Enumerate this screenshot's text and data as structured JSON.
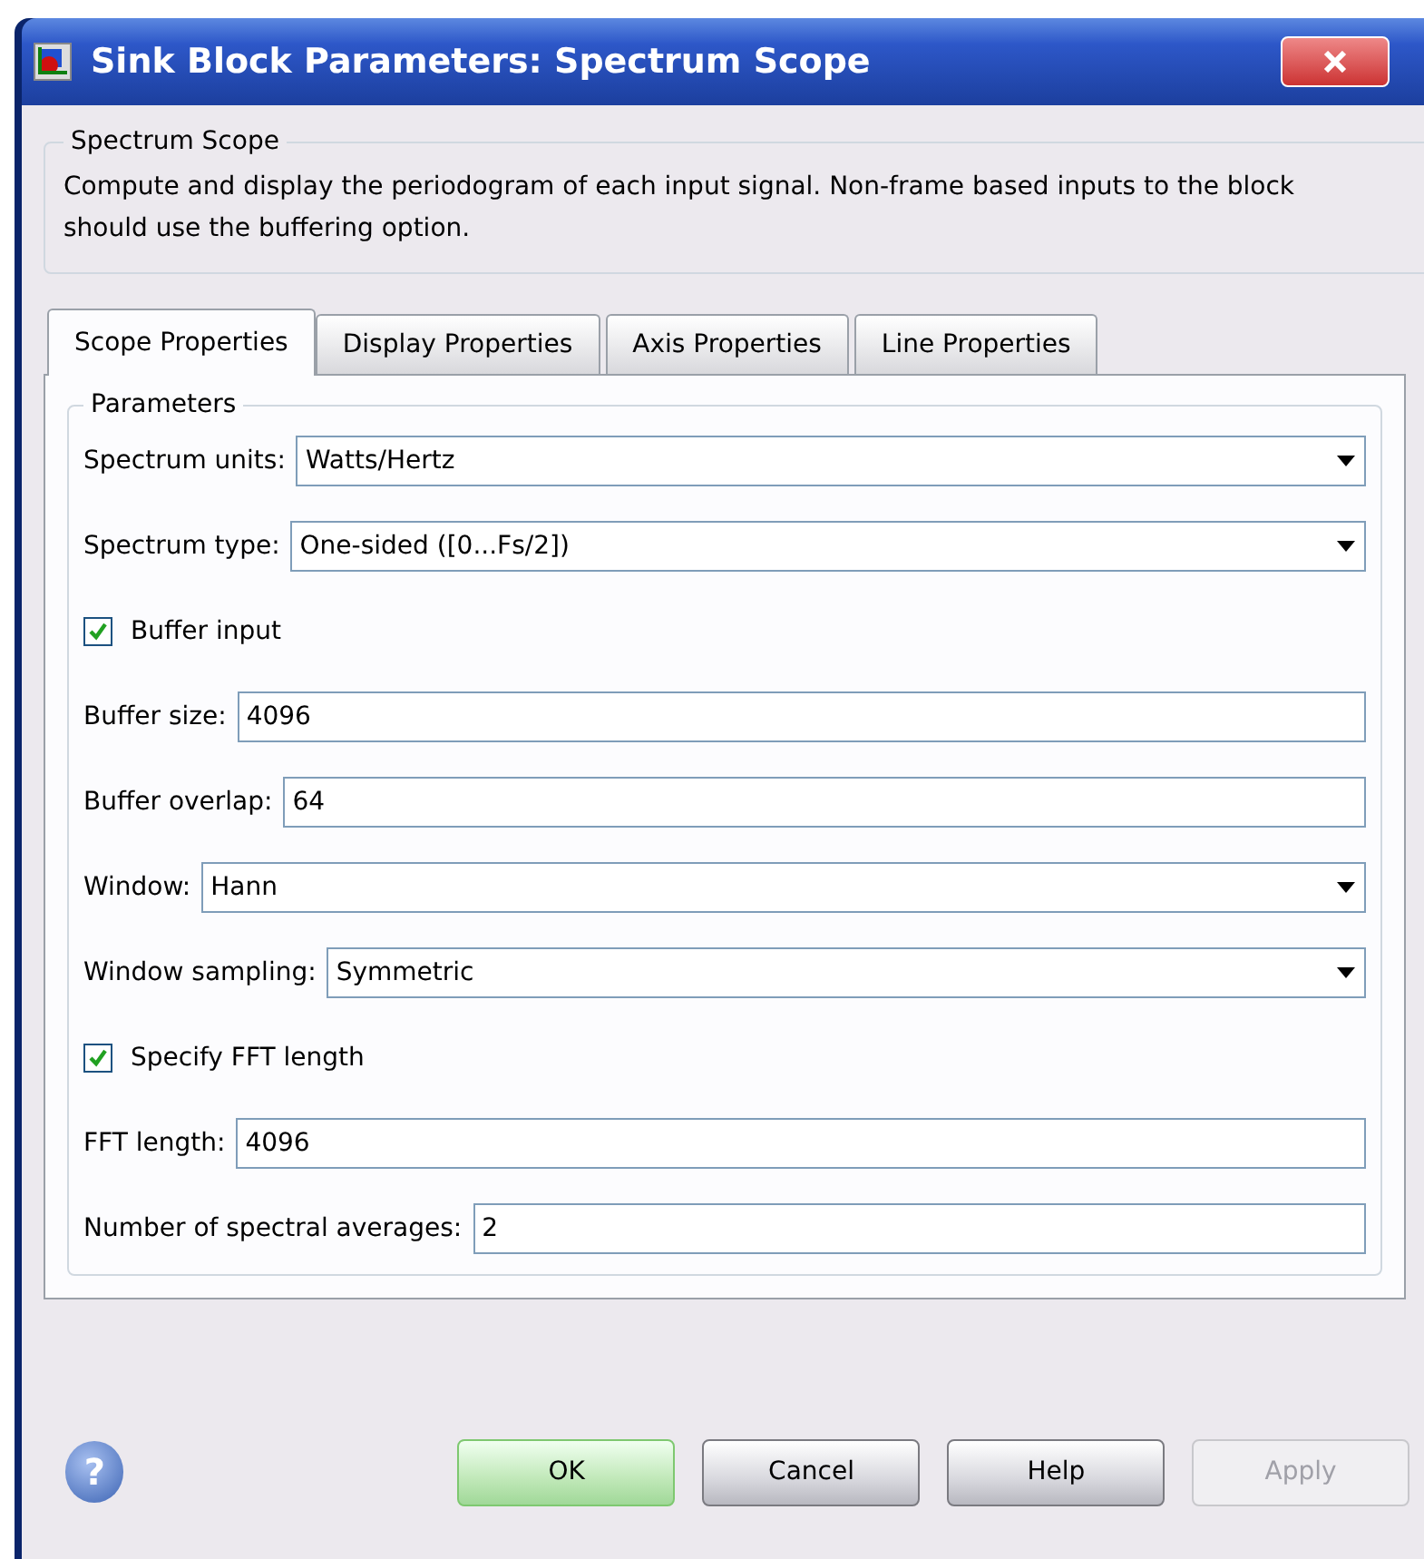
{
  "window": {
    "title": "Sink Block Parameters: Spectrum Scope"
  },
  "description_group": {
    "title": "Spectrum Scope",
    "text": "Compute and display the periodogram of each input signal.  Non-frame based inputs to the block should use the buffering option."
  },
  "tabs": [
    {
      "label": "Scope Properties",
      "selected": true
    },
    {
      "label": "Display Properties",
      "selected": false
    },
    {
      "label": "Axis Properties",
      "selected": false
    },
    {
      "label": "Line Properties",
      "selected": false
    }
  ],
  "parameters": {
    "title": "Parameters",
    "fields": [
      {
        "kind": "dropdown",
        "label": "Spectrum units:",
        "value": "Watts/Hertz"
      },
      {
        "kind": "dropdown",
        "label": "Spectrum type:",
        "value": "One-sided ([0...Fs/2])"
      },
      {
        "kind": "checkbox",
        "label": "Buffer input",
        "checked": true
      },
      {
        "kind": "text",
        "label": "Buffer size:",
        "value": "4096"
      },
      {
        "kind": "text",
        "label": "Buffer overlap:",
        "value": "64"
      },
      {
        "kind": "dropdown",
        "label": "Window:",
        "value": "Hann"
      },
      {
        "kind": "dropdown",
        "label": "Window sampling:",
        "value": "Symmetric"
      },
      {
        "kind": "checkbox",
        "label": "Specify FFT length",
        "checked": true
      },
      {
        "kind": "text",
        "label": "FFT length:",
        "value": "4096"
      },
      {
        "kind": "text",
        "label": "Number of spectral averages:",
        "value": "2"
      }
    ]
  },
  "help_icon": "?",
  "buttons": [
    {
      "label": "OK",
      "kind": "default",
      "disabled": false
    },
    {
      "label": "Cancel",
      "kind": "normal",
      "disabled": false
    },
    {
      "label": "Help",
      "kind": "normal",
      "disabled": false
    },
    {
      "label": "Apply",
      "kind": "normal",
      "disabled": true
    }
  ]
}
